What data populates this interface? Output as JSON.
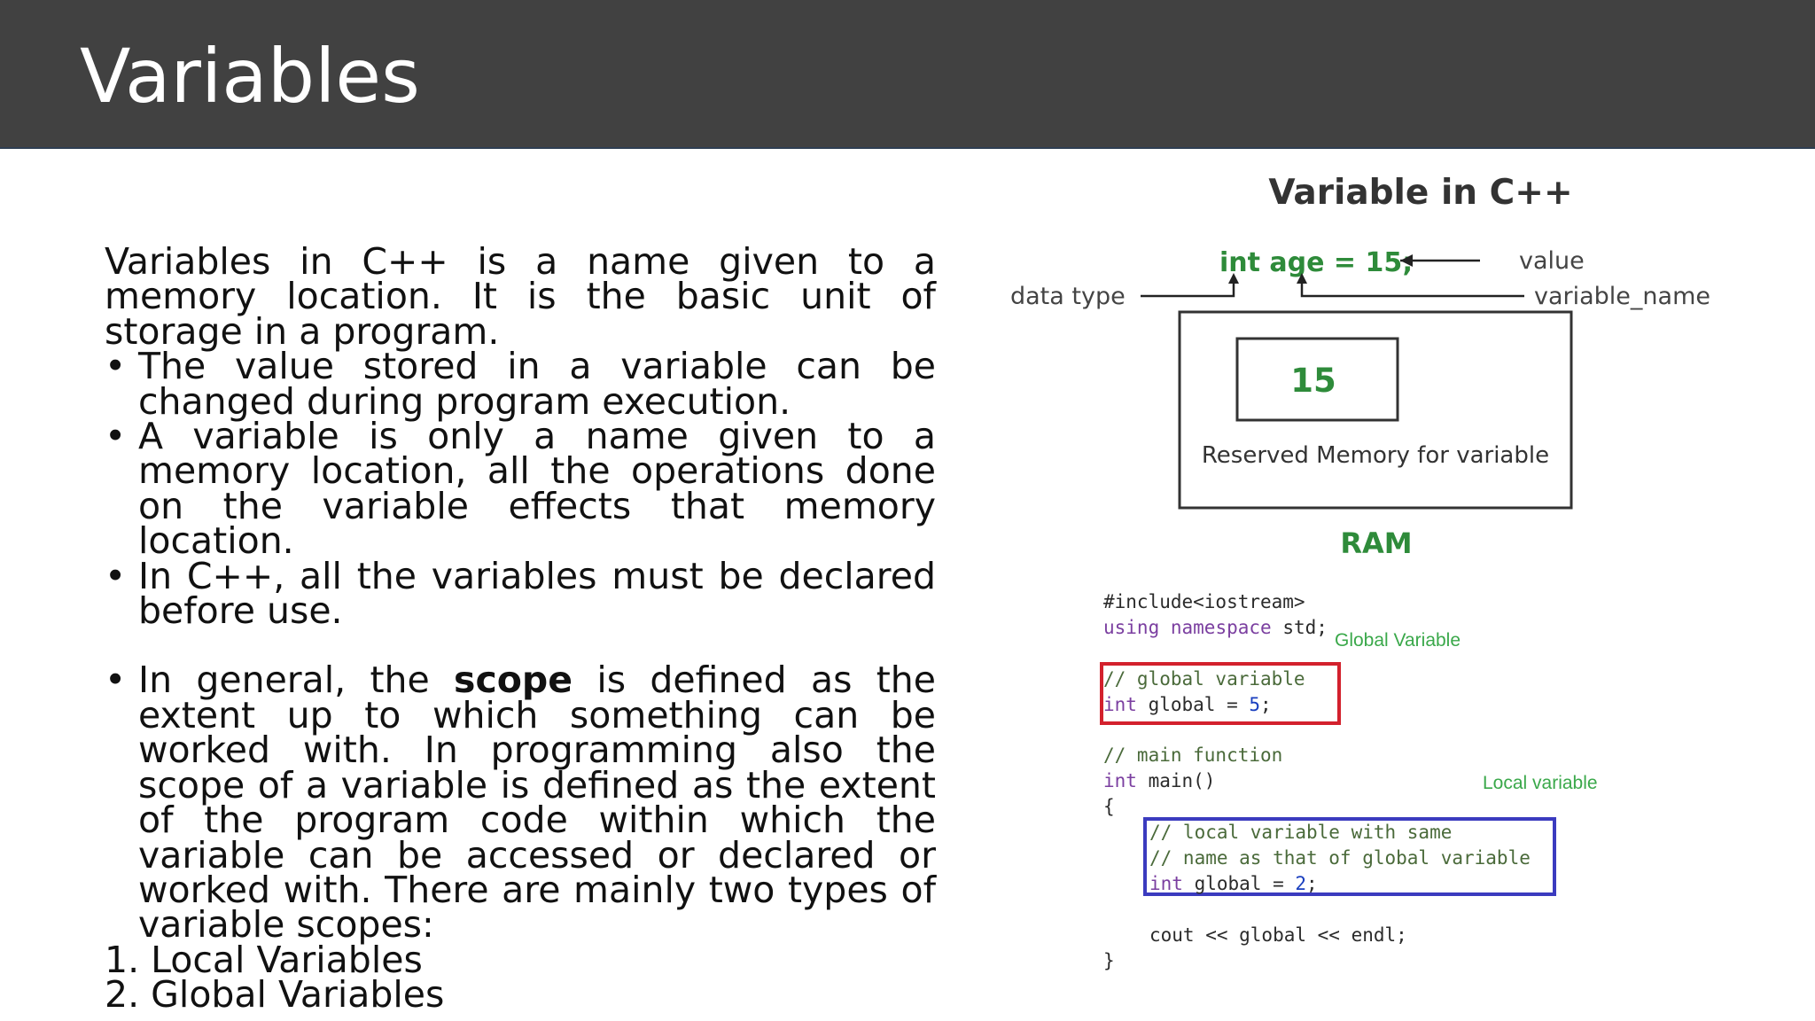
{
  "slide": {
    "title": "Variables"
  },
  "body": {
    "intro": "Variables in C++ is a name given to a memory location. It is the basic unit of storage in a program.",
    "bullets": [
      "The value stored in a variable can be changed during program execution.",
      "A variable is only a name given to a memory location, all the operations done on the variable effects that memory location.",
      "In C++, all the variables must be declared before use."
    ],
    "scope_bullet": {
      "before": "In general, the ",
      "bold": "scope",
      "after": " is defined as the extent up to which something can be worked with. In programming also the scope of a variable is defined as the extent of the program code within which the variable can be accessed or declared or worked with. There are mainly two types of variable scopes:"
    },
    "bullet_char": "•",
    "numbered": [
      "1. Local Variables",
      "2. Global Variables"
    ]
  },
  "diagram": {
    "title": "Variable in C++",
    "code_line": "int age = 15;",
    "label_value": "value",
    "label_data_type": "data type",
    "label_variable_name": "variable_name",
    "box_value": "15",
    "box_caption": "Reserved Memory for variable",
    "ram_label": "RAM",
    "green": "#2e8b3a"
  },
  "code": {
    "line1": "#include<iostream>",
    "line2_kw1": "using",
    "line2_kw2": "namespace",
    "line2_rest": "std;",
    "global_comment": "// global variable",
    "global_decl_kw": "int",
    "global_decl_rest": " global = ",
    "global_decl_num": "5",
    "global_decl_end": ";",
    "main_comment": "// main function",
    "main_kw": "int",
    "main_rest": " main()",
    "open_brace": "{",
    "local_comment1": "// local variable with same",
    "local_comment2": "// name as that of global variable",
    "local_decl_kw": "int",
    "local_decl_rest": " global = ",
    "local_decl_num": "2",
    "local_decl_end": ";",
    "cout_line": "cout << global << endl;",
    "close_brace": "}",
    "global_label": "Global Variable",
    "local_label": "Local variable"
  }
}
